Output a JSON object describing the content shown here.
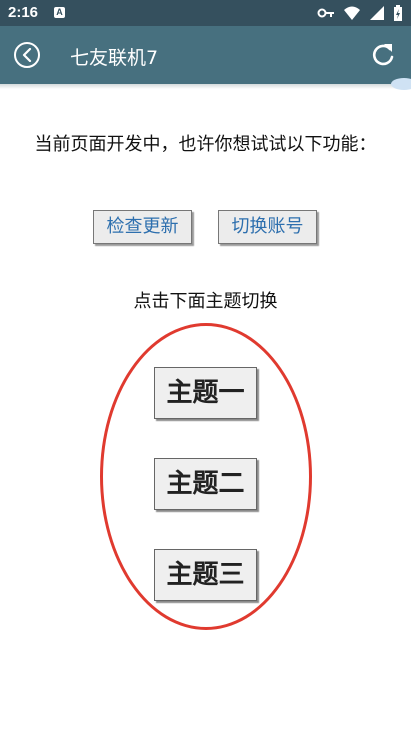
{
  "status_bar": {
    "time": "2:16",
    "notification_badge": "A",
    "icons": [
      "key-icon",
      "wifi-icon",
      "signal-icon",
      "battery-icon"
    ]
  },
  "app_bar": {
    "title": "七友联机7",
    "background": "#47707f",
    "icons": [
      "back-icon",
      "refresh-icon"
    ]
  },
  "main": {
    "intro_text": "当前页面开发中，也许你想试试以下功能：",
    "buttons": {
      "check_update": "检查更新",
      "switch_account": "切换账号"
    },
    "theme_hint": "点击下面主题切换",
    "themes": [
      "主题一",
      "主题二",
      "主题三"
    ],
    "highlight_color": "#e03a2f"
  }
}
